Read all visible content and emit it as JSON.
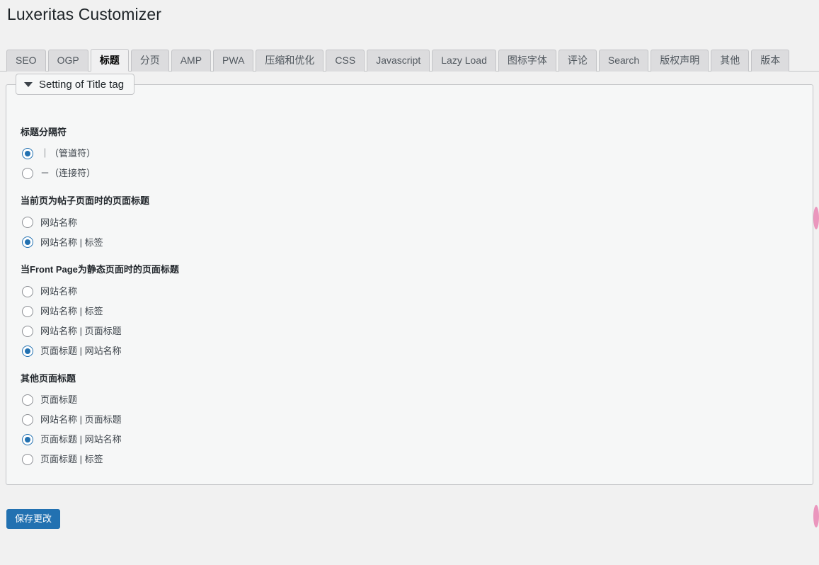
{
  "page": {
    "title": "Luxeritas Customizer"
  },
  "tabs": [
    {
      "label": "SEO",
      "active": false
    },
    {
      "label": "OGP",
      "active": false
    },
    {
      "label": "标题",
      "active": true
    },
    {
      "label": "分页",
      "active": false
    },
    {
      "label": "AMP",
      "active": false
    },
    {
      "label": "PWA",
      "active": false
    },
    {
      "label": "压缩和优化",
      "active": false
    },
    {
      "label": "CSS",
      "active": false
    },
    {
      "label": "Javascript",
      "active": false
    },
    {
      "label": "Lazy Load",
      "active": false
    },
    {
      "label": "图标字体",
      "active": false
    },
    {
      "label": "评论",
      "active": false
    },
    {
      "label": "Search",
      "active": false
    },
    {
      "label": "版权声明",
      "active": false
    },
    {
      "label": "其他",
      "active": false
    },
    {
      "label": "版本",
      "active": false
    }
  ],
  "panel": {
    "header_title": "Setting of Title tag",
    "caret_icon": "chevron-down-icon",
    "groups": [
      {
        "label": "标题分隔符",
        "options": [
          {
            "label": "｜（管道符）",
            "checked": true
          },
          {
            "label": "－（连接符）",
            "checked": false
          }
        ]
      },
      {
        "label": "当前页为帖子页面时的页面标题",
        "options": [
          {
            "label": "网站名称",
            "checked": false
          },
          {
            "label": "网站名称 | 标签",
            "checked": true
          }
        ]
      },
      {
        "label": "当Front Page为静态页面时的页面标题",
        "options": [
          {
            "label": "网站名称",
            "checked": false
          },
          {
            "label": "网站名称 | 标签",
            "checked": false
          },
          {
            "label": "网站名称 | 页面标题",
            "checked": false
          },
          {
            "label": "页面标题 | 网站名称",
            "checked": true
          }
        ]
      },
      {
        "label": "其他页面标题",
        "options": [
          {
            "label": "页面标题",
            "checked": false
          },
          {
            "label": "网站名称 | 页面标题",
            "checked": false
          },
          {
            "label": "页面标题 | 网站名称",
            "checked": true
          },
          {
            "label": "页面标题 | 标签",
            "checked": false
          }
        ]
      }
    ]
  },
  "actions": {
    "save_label": "保存更改"
  },
  "colors": {
    "accent": "#2271b1",
    "page_background": "#f1f1f1",
    "panel_background": "#f6f7f7",
    "tab_inactive": "#dcdcde",
    "border": "#c3c4c7",
    "edge_marker": "#eb96bd"
  }
}
